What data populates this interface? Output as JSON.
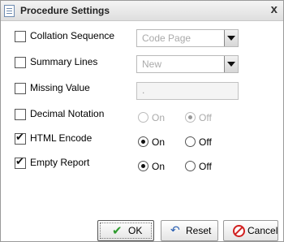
{
  "dialog": {
    "title": "Procedure Settings",
    "close_label": "x"
  },
  "settings": {
    "collation_sequence": {
      "label": "Collation Sequence",
      "checked": false,
      "dropdown_value": "Code Page"
    },
    "summary_lines": {
      "label": "Summary Lines",
      "checked": false,
      "dropdown_value": "New"
    },
    "missing_value": {
      "label": "Missing Value",
      "checked": false,
      "field_value": "."
    },
    "decimal_notation": {
      "label": "Decimal Notation",
      "checked": false,
      "on_label": "On",
      "off_label": "Off",
      "selected": "Off",
      "enabled": false
    },
    "html_encode": {
      "label": "HTML Encode",
      "checked": true,
      "on_label": "On",
      "off_label": "Off",
      "selected": "On",
      "enabled": true
    },
    "empty_report": {
      "label": "Empty Report",
      "checked": true,
      "on_label": "On",
      "off_label": "Off",
      "selected": "On",
      "enabled": true
    }
  },
  "buttons": {
    "ok": "OK",
    "reset": "Reset",
    "cancel": "Cancel"
  }
}
